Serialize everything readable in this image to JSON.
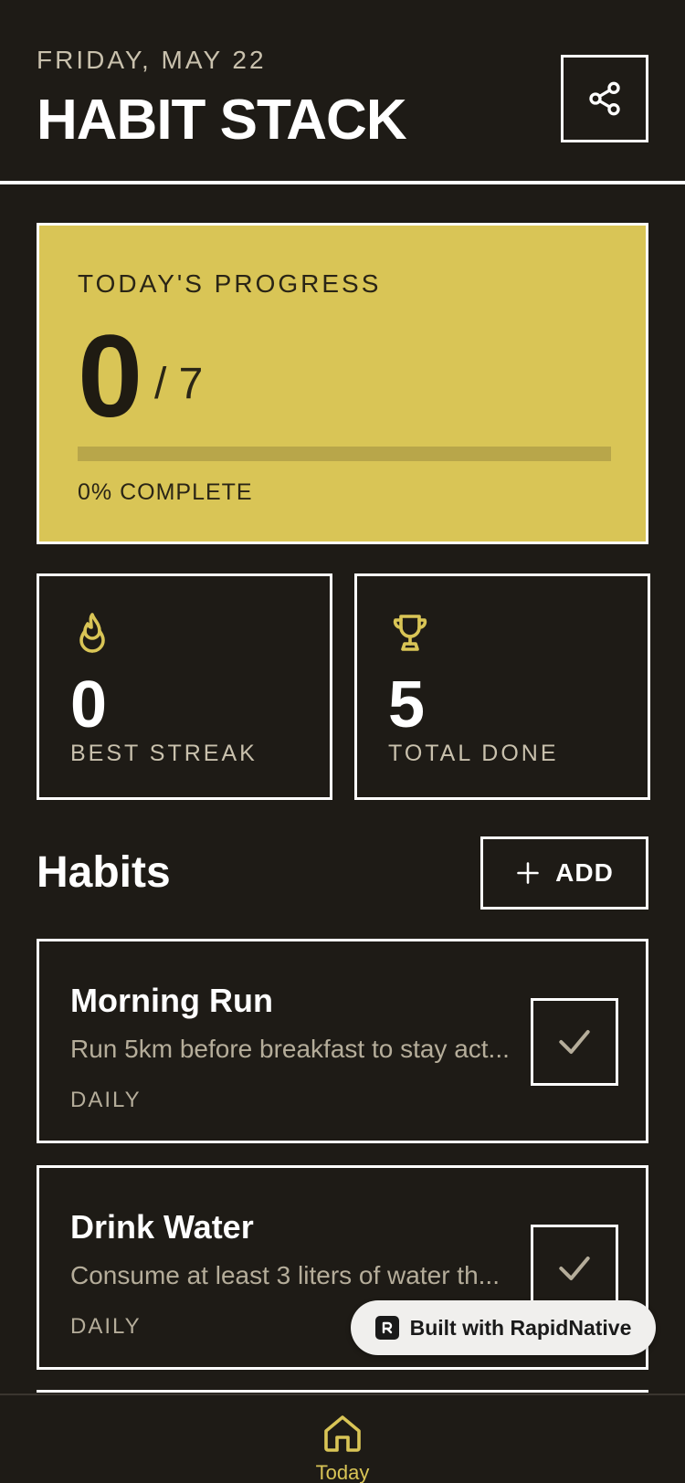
{
  "header": {
    "date": "FRIDAY, MAY 22",
    "title": "HABIT STACK",
    "share_icon": "share-icon"
  },
  "progress": {
    "label": "TODAY'S PROGRESS",
    "completed": "0",
    "total": "/ 7",
    "percent": 0,
    "percent_label": "0% COMPLETE"
  },
  "stats": [
    {
      "icon": "flame-icon",
      "value": "0",
      "label": "BEST STREAK"
    },
    {
      "icon": "trophy-icon",
      "value": "5",
      "label": "TOTAL DONE"
    }
  ],
  "habits_section": {
    "title": "Habits",
    "add_label": "ADD",
    "add_icon": "plus-icon"
  },
  "habits": [
    {
      "name": "Morning Run",
      "description": "Run 5km before breakfast to stay act...",
      "frequency": "DAILY"
    },
    {
      "name": "Drink Water",
      "description": "Consume at least 3 liters of water th...",
      "frequency": "DAILY"
    }
  ],
  "badge": {
    "text": "Built with RapidNative"
  },
  "nav": {
    "today_label": "Today"
  },
  "colors": {
    "background": "#1e1b16",
    "accent": "#d9c556",
    "border": "#ffffff",
    "muted_text": "#c9c1ad"
  }
}
